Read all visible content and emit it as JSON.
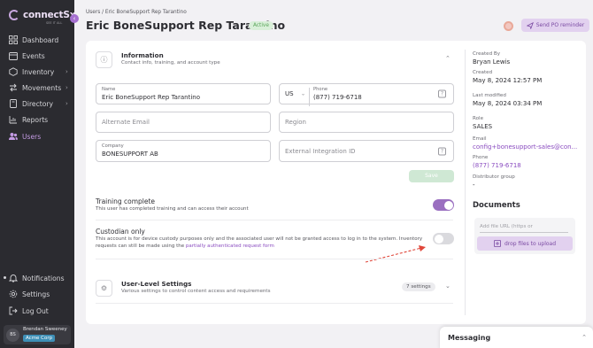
{
  "brand": {
    "name": "connectSx",
    "tagline": "SEE IT ALL",
    "collapse_glyph": "‹"
  },
  "sidebar": {
    "nav": [
      {
        "label": "Dashboard",
        "icon": "grid-icon",
        "has_submenu": false
      },
      {
        "label": "Events",
        "icon": "calendar-icon",
        "has_submenu": false
      },
      {
        "label": "Inventory",
        "icon": "box-icon",
        "has_submenu": true
      },
      {
        "label": "Movements",
        "icon": "arrows-icon",
        "has_submenu": true
      },
      {
        "label": "Directory",
        "icon": "book-icon",
        "has_submenu": true
      },
      {
        "label": "Reports",
        "icon": "chart-icon",
        "has_submenu": false
      },
      {
        "label": "Users",
        "icon": "users-icon",
        "has_submenu": false,
        "active": true
      }
    ],
    "bottom": [
      {
        "label": "Notifications",
        "icon": "bell-icon"
      },
      {
        "label": "Settings",
        "icon": "gear-icon"
      },
      {
        "label": "Log Out",
        "icon": "logout-icon"
      }
    ],
    "user": {
      "initials": "BS",
      "name": "Brendan Sweeney",
      "org": "Acme Corp"
    }
  },
  "header": {
    "breadcrumb": "Users / Eric BoneSupport Rep Tarantino",
    "title": "Eric BoneSupport Rep Tarantino",
    "status": "Active",
    "po_button": "Send PO reminder"
  },
  "info": {
    "title": "Information",
    "subtitle": "Contact info, training, and account type",
    "name_label": "Name",
    "name_value": "Eric BoneSupport Rep Tarantino",
    "country_code": "US",
    "phone_label": "Phone",
    "phone_value": "(877) 719-6718",
    "alt_email_placeholder": "Alternate Email",
    "region_placeholder": "Region",
    "company_label": "Company",
    "company_value": "BONESUPPORT AB",
    "ext_id_placeholder": "External Integration ID",
    "save_label": "Save",
    "help_glyph": "?"
  },
  "training": {
    "title": "Training complete",
    "desc": "This user has completed training and can access their account",
    "enabled": true
  },
  "custodian": {
    "title": "Custodian only",
    "desc": "This account is for device custody purposes only and the associated user will not be granted access to log in to the system. Inventory requests can still be made using the",
    "link": "partially authenticated request form",
    "enabled": false
  },
  "user_level": {
    "title": "User-Level Settings",
    "subtitle": "Various settings to control content access and requirements",
    "count": "7 settings"
  },
  "meta": {
    "created_by_label": "Created By",
    "created_by": "Bryan Lewis",
    "created_label": "Created",
    "created": "May 8, 2024 12:57 PM",
    "modified_label": "Last modified",
    "modified": "May 8, 2024 03:34 PM",
    "role_label": "Role",
    "role": "SALES",
    "email_label": "Email",
    "email": "config+bonesupport-sales@con...",
    "phone_label": "Phone",
    "phone": "(877) 719-6718",
    "distributor_label": "Distributor group",
    "distributor": "-"
  },
  "documents": {
    "title": "Documents",
    "url_placeholder": "Add file URL (https or",
    "drop_label": "drop files to upload"
  },
  "messaging": {
    "title": "Messaging"
  },
  "colors": {
    "accent": "#9a6fc0",
    "sidebar": "#2b2b30",
    "active_badge": "#5aa55a",
    "org_badge": "#3e8fb6"
  }
}
